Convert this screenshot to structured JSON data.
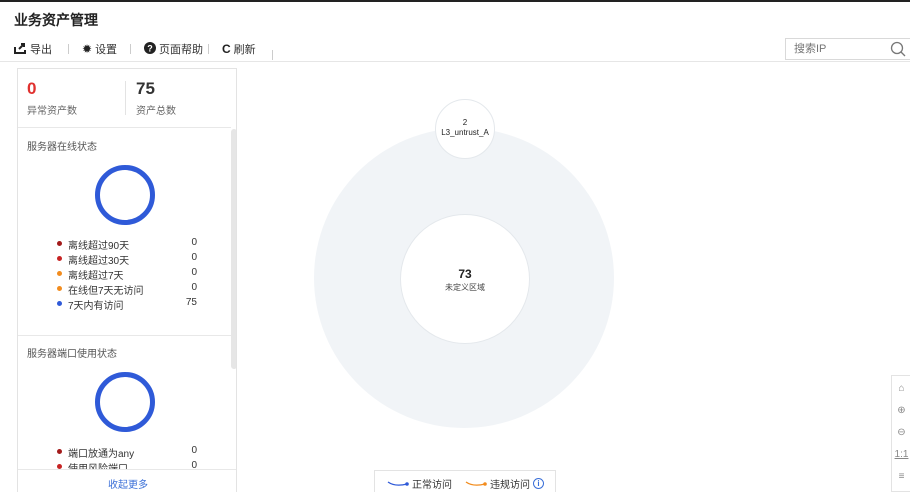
{
  "header": {
    "title": "业务资产管理"
  },
  "toolbar": {
    "export_label": "导出",
    "settings_label": "设置",
    "help_label": "页面帮助",
    "refresh_label": "刷新"
  },
  "search": {
    "placeholder": "搜索IP"
  },
  "stats": {
    "abnormal": {
      "value": "0",
      "label": "异常资产数",
      "color": "#e0312f"
    },
    "total": {
      "value": "75",
      "label": "资产总数"
    }
  },
  "online_section": {
    "title": "服务器在线状态",
    "ring_color": "#2f5ad8",
    "items": [
      {
        "label": "离线超过90天",
        "value": "0",
        "color": "#a31b1b"
      },
      {
        "label": "离线超过30天",
        "value": "0",
        "color": "#c62323"
      },
      {
        "label": "离线超过7天",
        "value": "0",
        "color": "#f28c1e"
      },
      {
        "label": "在线但7天无访问",
        "value": "0",
        "color": "#f28c1e"
      },
      {
        "label": "7天内有访问",
        "value": "75",
        "color": "#2f5ad8"
      }
    ]
  },
  "port_section": {
    "title": "服务器端口使用状态",
    "ring_color": "#2f5ad8",
    "items": [
      {
        "label": "端口放通为any",
        "value": "0",
        "color": "#a31b1b"
      },
      {
        "label": "使用风险端口",
        "value": "0",
        "color": "#c62323"
      }
    ]
  },
  "collapse_label": "收起更多",
  "graph": {
    "center": {
      "count": "73",
      "label": "未定义区域"
    },
    "zone": {
      "count": "2",
      "label": "L3_untrust_A"
    }
  },
  "bottom_legend": {
    "normal_label": "正常访问",
    "normal_color": "#2f5ad8",
    "violation_label": "违规访问",
    "violation_color": "#f28c1e"
  },
  "zoom_controls": {
    "reset_label": "1:1"
  }
}
